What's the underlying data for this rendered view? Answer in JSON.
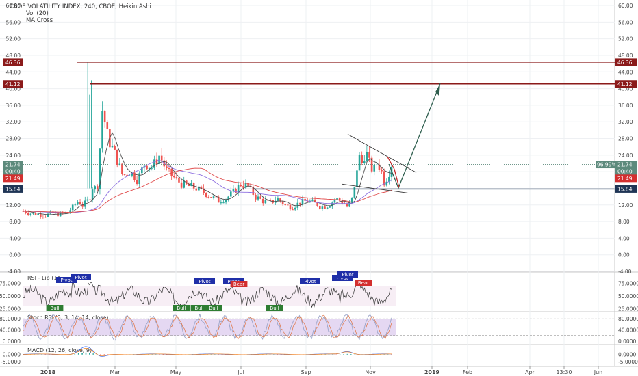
{
  "header": {
    "title": "CBOE VOLATILITY INDEX, 240, CBOE, Heikin Ashi",
    "studies": [
      "Vol (20)",
      "MA Cross"
    ]
  },
  "chart_data": {
    "type": "line",
    "symbol": "CBOE VOLATILITY INDEX",
    "interval": "240",
    "style": "Heikin Ashi",
    "x_ticks": [
      "2018",
      "Mar",
      "May",
      "Jul",
      "Sep",
      "Nov",
      "2019",
      "Feb",
      "Apr",
      "13:30",
      "Jun"
    ],
    "price_axis": {
      "ylim": [
        -4.0,
        60.0
      ],
      "ticks": [
        "60.00",
        "56.00",
        "52.00",
        "48.00",
        "44.00",
        "40.00",
        "36.00",
        "32.00",
        "28.00",
        "24.00",
        "20.00",
        "16.00",
        "12.00",
        "8.00",
        "4.00",
        "0.00",
        "-4.00"
      ]
    },
    "price_labels": [
      {
        "text": "46.36",
        "value": 46.36,
        "color": "#8b1a1a"
      },
      {
        "text": "41.12",
        "value": 41.12,
        "color": "#8b1a1a"
      },
      {
        "text": "21.74",
        "value": 21.74,
        "color": "#5d8a7c"
      },
      {
        "text": "00:40",
        "value": 20.1,
        "color": "#5d8a7c"
      },
      {
        "text": "21.49",
        "value": 18.4,
        "color": "#d32f2f"
      },
      {
        "text": "15.84",
        "value": 15.84,
        "color": "#1f3555"
      }
    ],
    "percent_label": "96.99%",
    "series": [
      {
        "name": "VIX",
        "x": [
          0,
          0.02,
          0.04,
          0.06,
          0.08,
          0.1,
          0.12,
          0.135,
          0.15,
          0.16,
          0.17,
          0.18,
          0.19,
          0.2,
          0.215,
          0.23,
          0.25,
          0.27,
          0.29,
          0.31,
          0.33,
          0.35,
          0.37,
          0.39,
          0.41,
          0.43,
          0.45,
          0.47,
          0.49,
          0.51,
          0.53,
          0.55,
          0.57,
          0.59,
          0.61,
          0.63,
          0.65,
          0.67,
          0.69,
          0.71,
          0.73,
          0.75,
          0.77,
          0.79,
          0.81,
          0.83,
          0.85,
          0.87,
          0.88,
          0.89,
          0.9,
          0.91,
          0.92,
          0.93,
          0.94,
          0.95,
          0.96,
          0.97,
          0.98,
          0.99,
          1.0
        ],
        "values": [
          10.5,
          10.0,
          9.8,
          9.5,
          10.0,
          9.7,
          10.2,
          11.5,
          13.0,
          11.8,
          12.5,
          13.5,
          17.0,
          15.0,
          35.0,
          28.0,
          24.0,
          19.0,
          20.0,
          18.0,
          22.0,
          21.0,
          24.0,
          20.0,
          18.5,
          17.0,
          16.5,
          16.0,
          15.0,
          14.0,
          13.0,
          13.5,
          15.0,
          17.0,
          16.5,
          14.0,
          13.0,
          12.5,
          13.5,
          12.0,
          11.5,
          12.5,
          13.0,
          12.5,
          11.5,
          12.0,
          13.5,
          12.5,
          11.5,
          12.5,
          16.0,
          24.0,
          22.0,
          25.0,
          22.0,
          20.0,
          22.0,
          21.0,
          17.5,
          19.0,
          21.74
        ]
      }
    ]
  },
  "indicators": [
    {
      "name": "RSI",
      "label": "RSI - Lib (14, ...",
      "ticks": [
        "75.0000",
        "50.0000",
        "25.0000"
      ],
      "markers": [
        "Pivot",
        "Pivot",
        "Pivot",
        "Pivot",
        "Bear",
        "Pivot",
        "Pivot",
        "Pivot",
        "Bear",
        "Bull",
        "Bull",
        "Bull",
        "Bull",
        "Bull"
      ]
    },
    {
      "name": "Stoch RSI",
      "label": "Stoch RSI (3, 3, 14, 14, close)",
      "ticks": [
        "80.0000",
        "40.0000",
        "0.0000"
      ]
    },
    {
      "name": "MACD",
      "label": "MACD (12, 26, close, 9)",
      "ticks": [
        "0.0000",
        "-5.0000"
      ]
    }
  ],
  "colors": {
    "up": "#26a69a",
    "down": "#ef5350",
    "resistance": "#8b1a1a",
    "support": "#1f3555",
    "projection_up": "#2e5e4e",
    "projection_down": "#c62828",
    "rsi_line": "#333333",
    "rsi_band": "#f7eef5",
    "stoch_band": "#e5d8f2",
    "stoch_k": "#9aa3c8",
    "stoch_d": "#e07b4f",
    "macd": "#3a6ff7",
    "signal": "#f28b30"
  }
}
